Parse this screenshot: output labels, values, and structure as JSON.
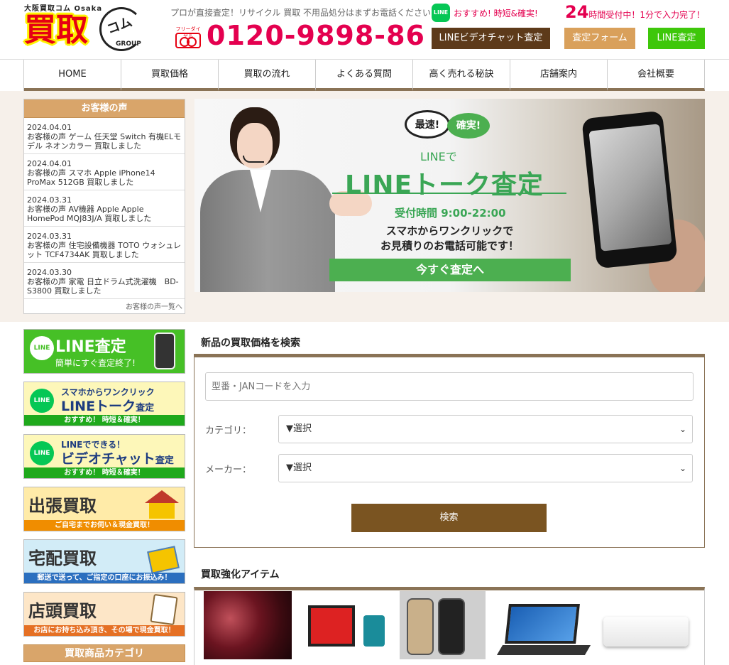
{
  "header": {
    "logo_small": "大阪買取コム Osaka",
    "logo_main": "買取",
    "logo_koma": "コム",
    "logo_group": "GROUP",
    "tagline": "プロが直接査定！リサイクル 買取 不用品処分はまずお電話ください！",
    "freedial_label": "フリーダイヤル",
    "phone": "0120-9898-86",
    "line_badge": "LINE",
    "line_osusume": "おすすめ! 時短&確実!",
    "hours_num": "24",
    "hours_text": "時間受付中！1分で入力完了！",
    "btn_video": "LINEビデオチャット査定",
    "btn_form": "査定フォーム",
    "btn_line": "LINE査定"
  },
  "nav": [
    "HOME",
    "買取価格",
    "買取の流れ",
    "よくある質問",
    "高く売れる秘訣",
    "店舗案内",
    "会社概要"
  ],
  "voice": {
    "title": "お客様の声",
    "items": [
      {
        "date": "2024.04.01",
        "text": "お客様の声 ゲーム 任天堂 Switch 有機ELモデル ネオンカラー 買取しました"
      },
      {
        "date": "2024.04.01",
        "text": "お客様の声 スマホ Apple iPhone14 ProMax 512GB 買取しました"
      },
      {
        "date": "2024.03.31",
        "text": "お客様の声 AV機器 Apple Apple HomePod MQJ83J/A 買取しました"
      },
      {
        "date": "2024.03.31",
        "text": "お客様の声 住宅設備機器 TOTO ウォシュレット TCF4734AK 買取しました"
      },
      {
        "date": "2024.03.30",
        "text": "お客様の声 家電 日立ドラム式洗濯機　BD-S3800 買取しました"
      }
    ],
    "more": "お客様の声一覧へ"
  },
  "banner": {
    "bubble1": "最速!",
    "bubble2": "確実!",
    "line_de": "LINEで",
    "title": "LINEトーク査定",
    "hours": "受付時間 9:00-22:00",
    "desc1": "スマホからワンクリックで",
    "desc2": "お見積りのお電話可能です！",
    "cta": "今すぐ査定へ"
  },
  "sidebar": {
    "line_title": "LINE査定",
    "line_sub": "簡単にすぐ査定終了!",
    "talk_small": "スマホからワンクリック",
    "talk_big": "LINEトーク",
    "talk_suffix": "査定",
    "talk_strip": "おすすめ！ 時短＆確実！",
    "video_small": "LINEでできる！",
    "video_big": "ビデオチャット",
    "video_suffix": "査定",
    "video_strip": "おすすめ！ 時短＆確実！",
    "shutcho": "出張買取",
    "shutcho_strip": "ご自宅までお伺い＆現金買取！",
    "takuhai": "宅配買取",
    "takuhai_strip": "郵送で送って、ご指定の口座にお振込み！",
    "tento": "店頭買取",
    "tento_strip": "お店にお持ち込み頂き、その場で現金買取！",
    "category": "買取商品カテゴリ"
  },
  "search": {
    "title": "新品の買取価格を検索",
    "jan_placeholder": "型番・JANコードを入力",
    "category_label": "カテゴリ：",
    "category_value": "▼選択",
    "maker_label": "メーカー：",
    "maker_value": "▼選択",
    "button": "検索"
  },
  "items_title": "買取強化アイテム"
}
